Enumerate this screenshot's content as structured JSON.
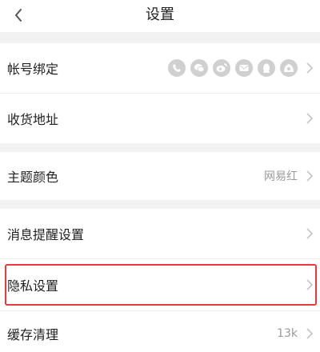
{
  "header": {
    "title": "设置"
  },
  "rows": [
    {
      "label": "帐号绑定",
      "social_icons": [
        "phone-icon",
        "wechat-icon",
        "weibo-icon",
        "email-icon",
        "qq-icon",
        "netease-icon"
      ]
    },
    {
      "label": "收货地址"
    },
    {
      "label": "主题颜色",
      "value": "网易红"
    },
    {
      "label": "消息提醒设置"
    },
    {
      "label": "隐私设置"
    },
    {
      "label": "缓存清理",
      "value": "13k"
    }
  ],
  "colors": {
    "highlight": "#e83a3a",
    "section_bg": "#f2f2f2"
  }
}
